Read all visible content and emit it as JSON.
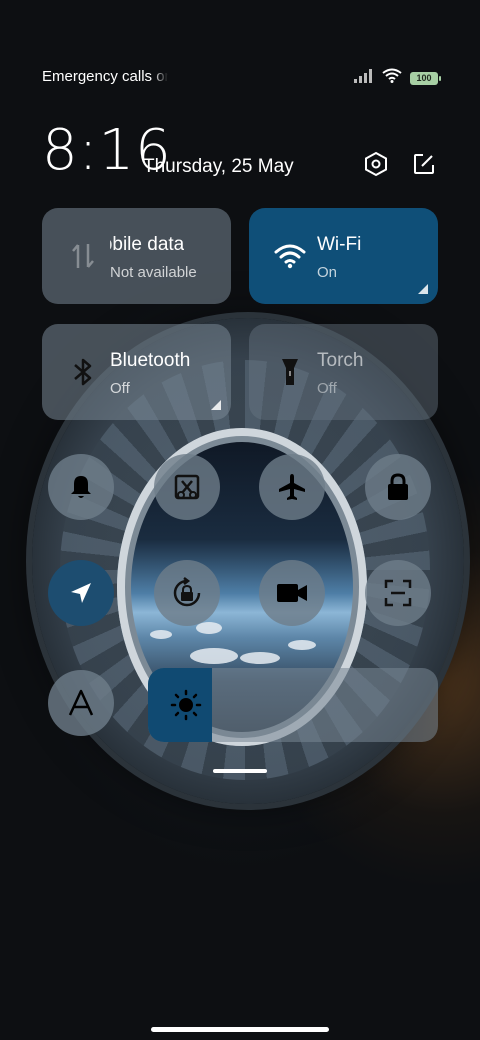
{
  "status_bar": {
    "carrier_text": "Emergency calls only",
    "battery_level": "100",
    "icons": [
      "signal-icon",
      "wifi-icon",
      "battery-icon"
    ]
  },
  "header": {
    "time": "8:16",
    "date": "Thursday, 25 May",
    "settings_icon": "settings-hexagon-icon",
    "edit_icon": "edit-icon"
  },
  "tiles": [
    {
      "label": "Mobile data",
      "sub": "Not available",
      "icon": "mobile-data-icon",
      "state": "unavailable"
    },
    {
      "label": "Wi-Fi",
      "sub": "On",
      "icon": "wifi-icon",
      "state": "on"
    },
    {
      "label": "Bluetooth",
      "sub": "Off",
      "icon": "bluetooth-icon",
      "state": "off"
    },
    {
      "label": "Torch",
      "sub": "Off",
      "icon": "torch-icon",
      "state": "off"
    }
  ],
  "toggles": [
    {
      "name": "ring",
      "icon": "bell-icon",
      "active": false
    },
    {
      "name": "screenshot",
      "icon": "scissors-screenshot-icon",
      "active": false
    },
    {
      "name": "airplane-mode",
      "icon": "airplane-icon",
      "active": false
    },
    {
      "name": "lock-screen",
      "icon": "lock-icon",
      "active": false
    },
    {
      "name": "location",
      "icon": "location-arrow-icon",
      "active": true
    },
    {
      "name": "auto-rotate-lock",
      "icon": "rotation-lock-icon",
      "active": false
    },
    {
      "name": "screen-recorder",
      "icon": "video-camera-icon",
      "active": false
    },
    {
      "name": "scanner",
      "icon": "scan-icon",
      "active": false
    },
    {
      "name": "font-size",
      "icon": "font-a-icon",
      "active": false
    }
  ],
  "brightness": {
    "level": 0.22,
    "icon": "sun-icon"
  },
  "colors": {
    "accent": "#0f4f78",
    "tile": "#78879480",
    "active_round": "#1d4d70"
  }
}
